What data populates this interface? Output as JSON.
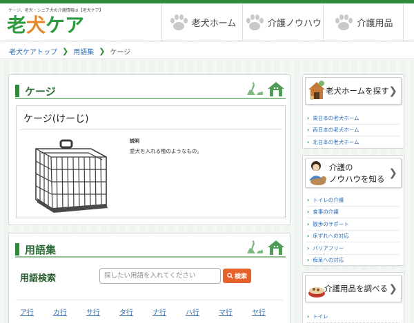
{
  "header": {
    "tagline": "ケージ、老犬・シニア犬の介護情報は【老犬ケア】",
    "logo_main": "老",
    "logo_dog": "犬",
    "logo_tail": "ケア",
    "nav": [
      {
        "label": "老犬ホーム"
      },
      {
        "label": "介護ノウハウ"
      },
      {
        "label": "介護用品"
      }
    ]
  },
  "breadcrumb": {
    "items": [
      "老犬ケアトップ",
      "用語集"
    ],
    "current": "ケージ"
  },
  "term_section": {
    "title": "ケージ",
    "term_title": "ケージ(けーじ)",
    "explanation_label": "説明",
    "explanation_text": "愛犬を入れる檻のようなもの。"
  },
  "glossary": {
    "title": "用語集",
    "search_label": "用語検索",
    "search_placeholder": "探したい用語を入れてください",
    "search_button": "検索",
    "kana_row1": [
      "ア行",
      "カ行",
      "サ行",
      "タ行",
      "ナ行",
      "ハ行",
      "マ行",
      "ヤ行"
    ]
  },
  "sidebar": {
    "home": {
      "heading": "老犬ホームを探す",
      "links": [
        "東日本の老犬ホーム",
        "西日本の老犬ホーム",
        "北日本の老犬ホーム"
      ]
    },
    "knowhow": {
      "heading_line1": "介護の",
      "heading_line2": "ノウハウを知る",
      "links": [
        "トイレの介護",
        "食事の介護",
        "散歩のサポート",
        "床ずれへの対応",
        "バリアフリー",
        "痴呆への対応"
      ]
    },
    "supplies": {
      "heading": "介護用品を調べる",
      "links": [
        "トイレ"
      ]
    }
  },
  "colors": {
    "brand_green": "#2e8b3a",
    "logo_green": "#2c9a3e",
    "logo_orange": "#e7892b",
    "search_button": "#e8602c",
    "link_blue": "#2e6fb5"
  }
}
